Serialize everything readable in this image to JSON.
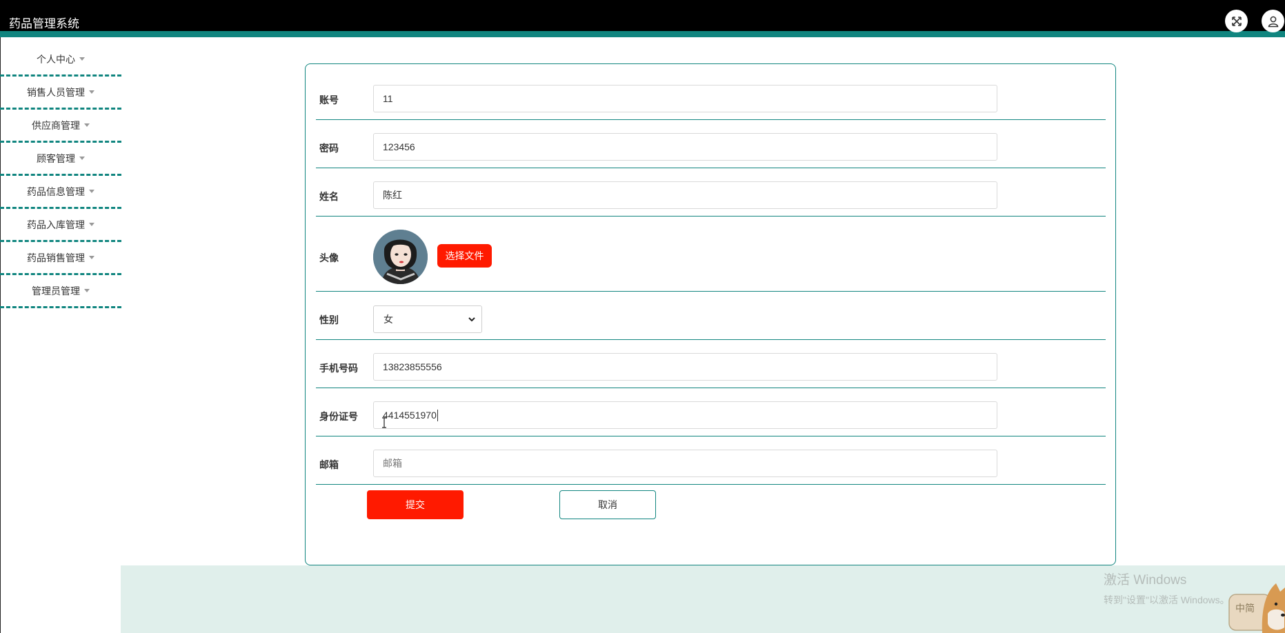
{
  "app": {
    "title": "药品管理系统"
  },
  "header_icons": {
    "fullscreen": "expand-arrows-icon",
    "user": "user-icon"
  },
  "sidebar": {
    "items": [
      {
        "label": "个人中心"
      },
      {
        "label": "销售人员管理"
      },
      {
        "label": "供应商管理"
      },
      {
        "label": "顾客管理"
      },
      {
        "label": "药品信息管理"
      },
      {
        "label": "药品入库管理"
      },
      {
        "label": "药品销售管理"
      },
      {
        "label": "管理员管理"
      }
    ]
  },
  "form": {
    "account": {
      "label": "账号",
      "value": "11"
    },
    "password": {
      "label": "密码",
      "value": "123456"
    },
    "name": {
      "label": "姓名",
      "value": "陈红"
    },
    "avatar": {
      "label": "头像",
      "upload_label": "选择文件"
    },
    "gender": {
      "label": "性别",
      "value": "女"
    },
    "phone": {
      "label": "手机号码",
      "value": "13823855556"
    },
    "id_number": {
      "label": "身份证号",
      "value": "4414551970"
    },
    "email": {
      "label": "邮箱",
      "value": "",
      "placeholder": "邮箱"
    },
    "submit_label": "提交",
    "cancel_label": "取消"
  },
  "watermark": {
    "line1": "激活 Windows",
    "line2": "转到\"设置\"以激活 Windows。"
  },
  "ime": {
    "label": "中简"
  },
  "colors": {
    "accent": "#10857f",
    "danger": "#ff1a00",
    "topbar": "#000000",
    "band": "#e0efeb"
  }
}
